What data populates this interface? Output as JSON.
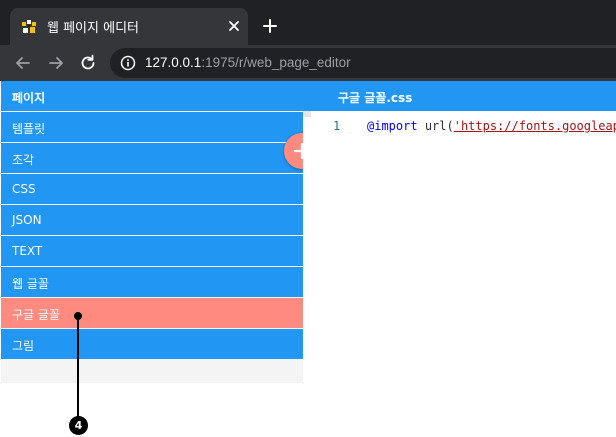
{
  "browser": {
    "tab_title": "웹 페이지 에디터",
    "url_host": "127.0.0.1",
    "url_path": ":1975/r/web_page_editor"
  },
  "sidebar": {
    "header": "페이지",
    "items": [
      {
        "label": "템플릿"
      },
      {
        "label": "조각"
      },
      {
        "label": "CSS"
      },
      {
        "label": "JSON"
      },
      {
        "label": "TEXT"
      },
      {
        "label": "웹 글꼴"
      },
      {
        "label": "구글 글꼴"
      },
      {
        "label": "그림"
      }
    ],
    "active_index": 6
  },
  "editor": {
    "title": "구글 글꼴.css",
    "line_number": "1",
    "code": {
      "keyword": "@import",
      "fn": "url",
      "open": "(",
      "string": "'https://fonts.googleapis.com"
    }
  },
  "annotation": {
    "badge": "4"
  },
  "colors": {
    "primary": "#2196f3",
    "accent": "#ff8a80",
    "chrome_dark": "#202124",
    "chrome_tab": "#35363a"
  },
  "icons": {
    "favicon": "app-favicon",
    "close": "close-icon",
    "new_tab": "plus-icon",
    "back": "back-arrow-icon",
    "forward": "forward-arrow-icon",
    "reload": "reload-icon",
    "info": "info-icon",
    "add": "add-icon"
  }
}
